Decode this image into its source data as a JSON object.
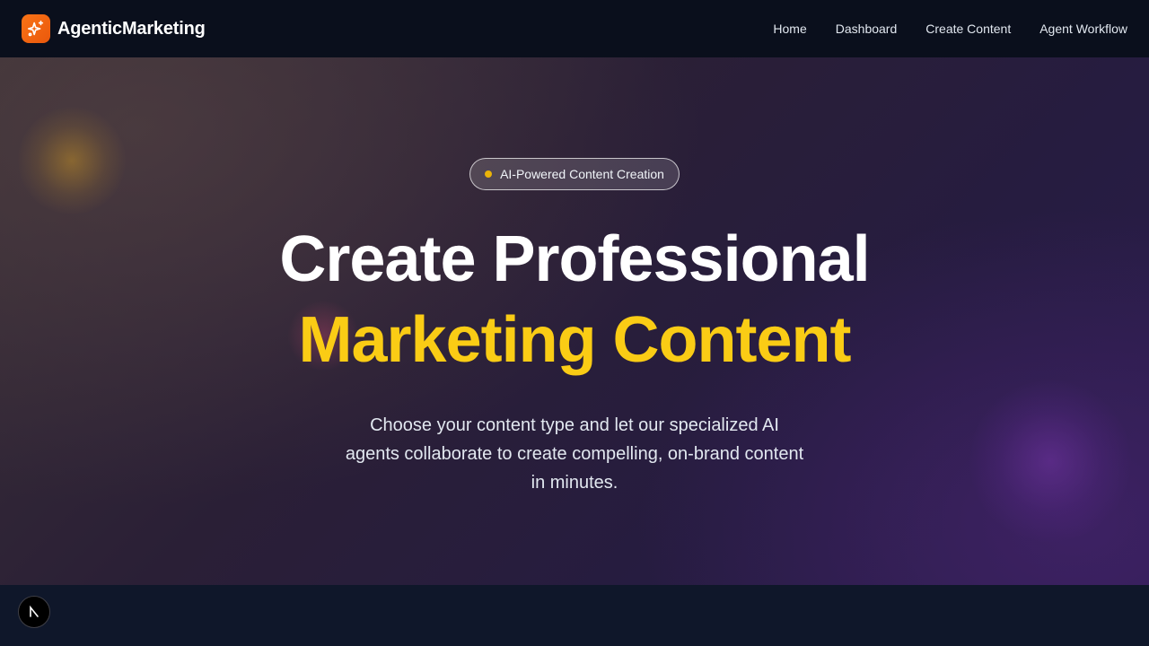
{
  "nav": {
    "brand": "AgenticMarketing",
    "brand_icon": "sparkles-icon",
    "links": [
      "Home",
      "Dashboard",
      "Create Content",
      "Agent Workflow"
    ]
  },
  "hero": {
    "badge": "AI-Powered Content Creation",
    "headline_line1": "Create Professional",
    "headline_line2": "Marketing Content",
    "subtitle": "Choose your content type and let our specialized AI agents collaborate to create compelling, on-brand content in minutes."
  },
  "dev_badge": {
    "icon": "nextjs-logo-icon"
  },
  "colors": {
    "brand_accent": "#f97316",
    "highlight": "#facc15",
    "nav_bg": "#0a0f1c"
  }
}
